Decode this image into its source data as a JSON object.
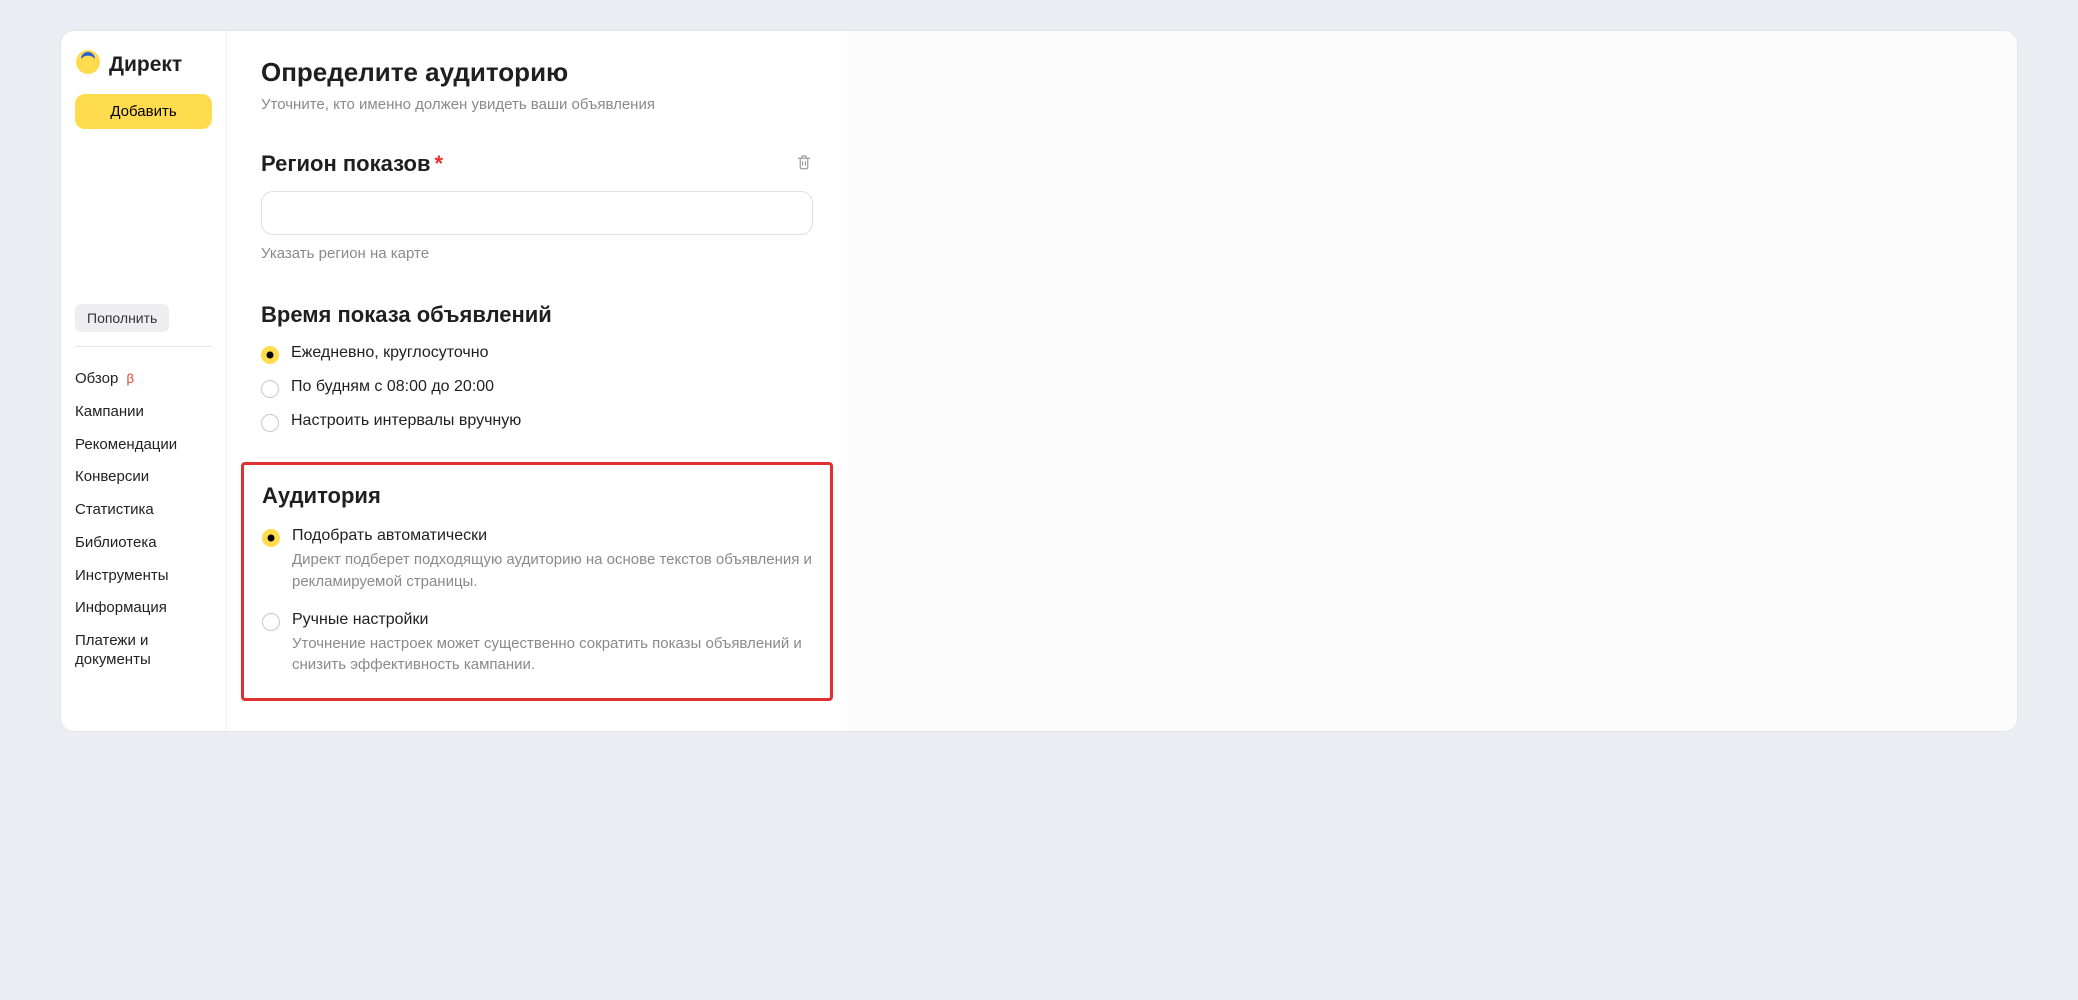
{
  "sidebar": {
    "brand": "Директ",
    "add_button": "Добавить",
    "topup_button": "Пополнить",
    "nav": [
      {
        "label": "Обзор",
        "beta": "β"
      },
      {
        "label": "Кампании"
      },
      {
        "label": "Рекомендации"
      },
      {
        "label": "Конверсии"
      },
      {
        "label": "Статистика"
      },
      {
        "label": "Библиотека"
      },
      {
        "label": "Инструменты"
      },
      {
        "label": "Информация"
      },
      {
        "label": "Платежи и документы"
      }
    ]
  },
  "panel": {
    "title": "Определите аудиторию",
    "subtitle": "Уточните, кто именно должен увидеть ваши объявления",
    "region": {
      "heading": "Регион показов",
      "required_mark": "*",
      "input_value": "",
      "map_link": "Указать регион на карте"
    },
    "schedule": {
      "heading": "Время показа объявлений",
      "options": [
        {
          "label": "Ежедневно, круглосуточно",
          "checked": true
        },
        {
          "label": "По будням с 08:00 до 20:00",
          "checked": false
        },
        {
          "label": "Настроить интервалы вручную",
          "checked": false
        }
      ]
    },
    "audience": {
      "heading": "Аудитория",
      "options": [
        {
          "label": "Подобрать автоматически",
          "desc": "Директ подберет подходящую аудиторию на основе текстов объявления и рекламируемой страницы.",
          "checked": true
        },
        {
          "label": "Ручные настройки",
          "desc": "Уточнение настроек может существенно сократить показы объявлений и снизить эффективность кампании.",
          "checked": false
        }
      ]
    }
  }
}
